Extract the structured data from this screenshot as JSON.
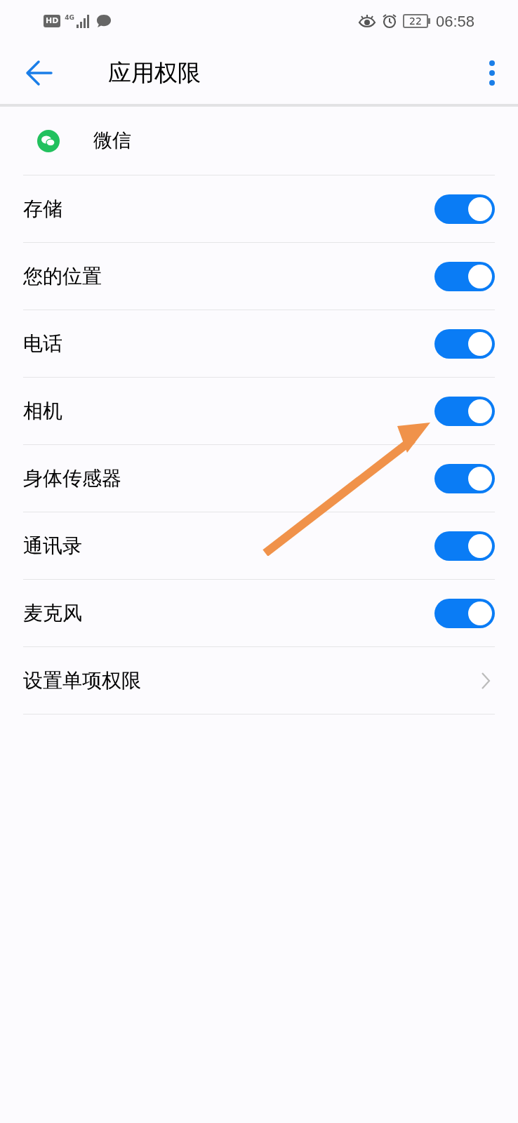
{
  "status_bar": {
    "hd_badge": "HD",
    "network": "4G",
    "battery": "22",
    "time": "06:58"
  },
  "header": {
    "title": "应用权限"
  },
  "app": {
    "name": "微信"
  },
  "permissions": [
    {
      "kind": "toggle",
      "label": "存储",
      "on": true
    },
    {
      "kind": "toggle",
      "label": "您的位置",
      "on": true
    },
    {
      "kind": "toggle",
      "label": "电话",
      "on": true
    },
    {
      "kind": "toggle",
      "label": "相机",
      "on": true
    },
    {
      "kind": "toggle",
      "label": "身体传感器",
      "on": true
    },
    {
      "kind": "toggle",
      "label": "通讯录",
      "on": true
    },
    {
      "kind": "toggle",
      "label": "麦克风",
      "on": true
    },
    {
      "kind": "link",
      "label": "设置单项权限"
    }
  ]
}
